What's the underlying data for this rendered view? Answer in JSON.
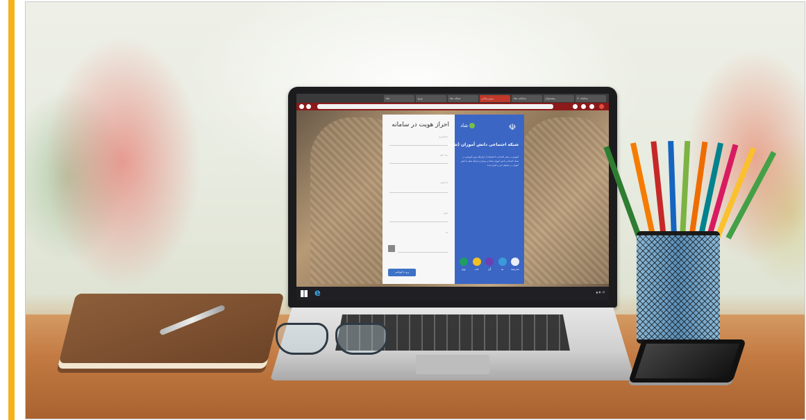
{
  "browser": {
    "tabs": [
      "+ سامانه",
      "پیشخوان",
      "سامانه شاد",
      "بروزرسانی",
      "شبکه شاد",
      "ورود",
      "شاد"
    ]
  },
  "login_card": {
    "title": "احراز هویت در سامانه",
    "fields": [
      "نام کاربری",
      "رمز عبور",
      "کد امنیتی",
      "تکرار",
      "کد"
    ],
    "button_label": "ورود با کوواکس"
  },
  "info_panel": {
    "logo_text": "شاد",
    "title": "شبکه اجتماعی دانش آموزان (شاد)",
    "description": "آموزش در بستر اجتماعی با استفاده از ابزارهای نوین آموزشی در شبکه اجتماعی دانش آموزان (شاد) و برقراری ارتباط معلم با دانش آموزان در محیطی امن و کنترل شده",
    "apps": [
      {
        "label": "مدرسه",
        "color": "#e9eef7"
      },
      {
        "label": "به",
        "color": "#3b9ad9"
      },
      {
        "label": "آی",
        "color": "#6d3fb5"
      },
      {
        "label": "تاب",
        "color": "#f3c022"
      },
      {
        "label": "بوم",
        "color": "#1e9e63"
      }
    ]
  },
  "colors": {
    "accent": "#f6b21a",
    "panel_blue": "#3c66c4",
    "browser_red": "#8b1a1a"
  }
}
